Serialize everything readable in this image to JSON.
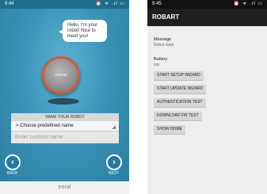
{
  "left": {
    "status_time": "9:44",
    "status_icons": "⏰ ᯤ .ıl ▭",
    "bubble_text": "Hello, I'm your robot! Nice to meet you!",
    "robot_label": "neutral",
    "name_panel": {
      "title": "NAME YOUR ROBOT",
      "predefined": "> Choose predefined name",
      "custom_placeholder": "Enter custom name"
    },
    "nav": {
      "back": "BACK",
      "next": "NEXT"
    },
    "footer_brand": "iroral"
  },
  "right": {
    "status_time": "9:45",
    "status_icons": "⏰ ᯤ .ıl ▭",
    "app_title": "ROBART",
    "message_label": "Message",
    "message_value": "Robot state",
    "battery_label": "Battery",
    "battery_value": "xxx",
    "buttons": [
      "START SETUP WIZARD",
      "START UPDATE WIZARD",
      "AUTHENTICATION TEST",
      "DOWNLOAD FW TEST",
      "SHOW HOME"
    ]
  }
}
